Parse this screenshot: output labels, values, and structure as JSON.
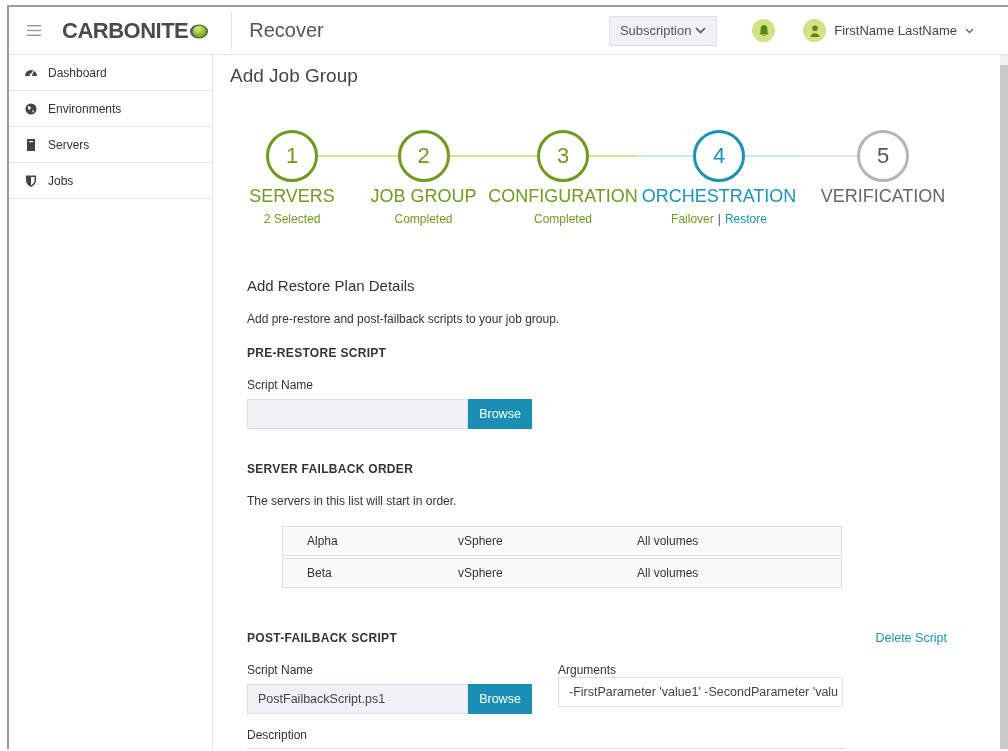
{
  "header": {
    "logo": "CARBONITE",
    "app_title": "Recover",
    "subscription": "Subscription",
    "user": "FirstName LastName"
  },
  "sidebar": {
    "items": [
      {
        "label": "Dashboard"
      },
      {
        "label": "Environments"
      },
      {
        "label": "Servers"
      },
      {
        "label": "Jobs"
      }
    ]
  },
  "page_title": "Add Job Group",
  "steps": [
    {
      "number": "1",
      "label": "SERVERS",
      "kind": "completed",
      "subtitle": [
        {
          "text": "2 Selected",
          "kind": "completed"
        }
      ]
    },
    {
      "number": "2",
      "label": "JOB GROUP",
      "kind": "completed",
      "subtitle": [
        {
          "text": "Completed",
          "kind": "completed"
        }
      ]
    },
    {
      "number": "3",
      "label": "CONFIGURATION",
      "kind": "completed",
      "subtitle": [
        {
          "text": "Completed",
          "kind": "completed"
        }
      ]
    },
    {
      "number": "4",
      "label": "ORCHESTRATION",
      "kind": "active",
      "subtitle": [
        {
          "text": "Failover",
          "kind": "completed"
        },
        {
          "text": "|",
          "kind": "separator"
        },
        {
          "text": "Restore",
          "kind": "active"
        }
      ]
    },
    {
      "number": "5",
      "label": "VERIFICATION",
      "kind": "pending"
    }
  ],
  "form": {
    "heading": "Add Restore Plan Details",
    "intro": "Add pre-restore and post-failback scripts to your job group.",
    "pre_restore": {
      "heading": "PRE-RESTORE SCRIPT",
      "script_label": "Script Name",
      "browse": "Browse"
    },
    "failback_order": {
      "heading": "SERVER FAILBACK ORDER",
      "note": "The servers in this list will start in order.",
      "rows": [
        {
          "name": "Alpha",
          "platform": "vSphere",
          "volumes": "All volumes"
        },
        {
          "name": "Beta",
          "platform": "vSphere",
          "volumes": "All volumes"
        }
      ]
    },
    "post_failback": {
      "heading": "POST-FAILBACK SCRIPT",
      "delete_link": "Delete Script",
      "script_label": "Script Name",
      "script_value": "PostFailbackScript.ps1",
      "browse": "Browse",
      "arguments_label": "Arguments",
      "arguments_value": "-FirstParameter 'value1' -SecondParameter 'valu",
      "description_label": "Description"
    }
  }
}
